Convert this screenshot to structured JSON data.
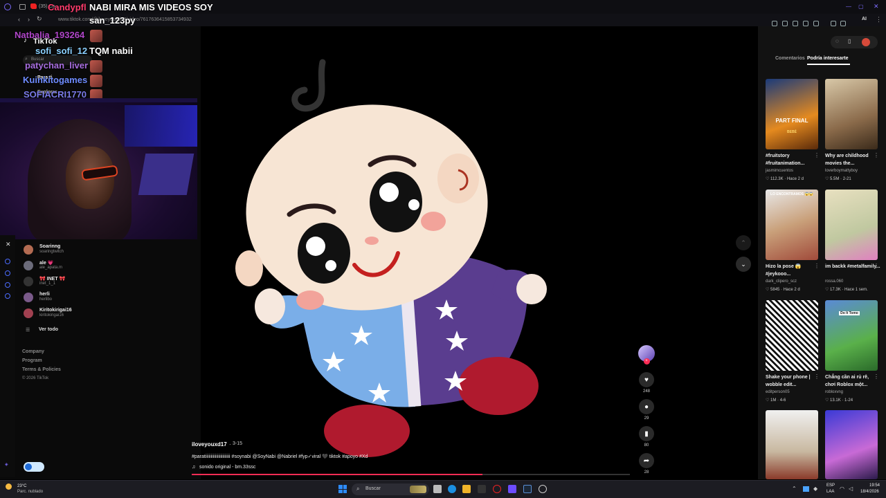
{
  "browser": {
    "tab_title": "(35) Ca",
    "url": "www.tiktok.com/@iloveyouxd17/video/7617636415853734932",
    "ext_label": "AI"
  },
  "stream": {
    "title": "NABI MIRA MIS VIDEOS SOY",
    "title_prefix_user": "Candypfl"
  },
  "chat": [
    {
      "user": "san_123py",
      "message": "",
      "color": "#ffffff"
    },
    {
      "user": "Natbalia_193264",
      "message": "",
      "color": "#b046c9"
    },
    {
      "user": "sofi_sofi_12",
      "message": "TQM nabii",
      "color": "#8ad0ff"
    },
    {
      "user": "patychan_liver",
      "message": "",
      "color": "#a86ee0"
    },
    {
      "user": "Kuinkitogames",
      "message": "",
      "color": "#6f8cff"
    },
    {
      "user": "SOFIACRI1770",
      "message": "",
      "color": "#7a7ae8"
    }
  ],
  "tiktok_nav": {
    "brand": "TikTok",
    "search_placeholder": "Buscar",
    "foryou": "Para ti",
    "explore": "Explorar"
  },
  "following": [
    {
      "name": "Soarinng",
      "handle": "soaringtwitch"
    },
    {
      "name": "ale 💗",
      "handle": "ale_apata.m"
    },
    {
      "name": "🎀 INET 🎀",
      "handle": "inet_1_1"
    },
    {
      "name": "herli",
      "handle": "herlibo"
    },
    {
      "name": "Kiritokirigai16",
      "handle": "kiritokirigai16"
    }
  ],
  "see_all": "Ver todo",
  "footer": [
    "Company",
    "Program",
    "Terms & Policies",
    "© 2026 TikTok"
  ],
  "video": {
    "author": "iloveyouxd17",
    "date": "3-15",
    "caption": "#paratiiiiiiiiiiiiiiiiiiiiiii #soynabi @SoyNabi @Nabriel #fyp✓viral 🖤 tiktok #apoyo #Xd",
    "sound": "sonido original - bm.33ssc",
    "likes": "248",
    "comments": "29",
    "saves": "80",
    "shares": "28"
  },
  "right_tabs": {
    "comments": "Comentarios",
    "related": "Podría interesarte"
  },
  "cards": [
    {
      "title": "#fruitstory #fruitanimation...",
      "author": "jasmimcuentos",
      "stats": "♡ 112.3K · Hace 2 d",
      "overlay": "PART FINAL",
      "overlay2": "BEBÉ"
    },
    {
      "title": "Why are childhood movies the...",
      "author": "loverboymattyboy",
      "stats": "♡ 5.5M · 2-21",
      "overlay": "",
      "overlay2": ""
    },
    {
      "title": "Hizo la pose 😱 #jeykooo...",
      "author": "dark_clipero_scz",
      "stats": "♡ 5845 · Hace 2 d",
      "overlay": "LO ENCONTRAMOS 😱😱",
      "overlay2": ""
    },
    {
      "title": "im backk #metalfamily...",
      "author": "rossa.060",
      "stats": "♡ 17.3K · Hace 1 sem.",
      "overlay": "",
      "overlay2": ""
    },
    {
      "title": "Shake your phone | wobble edit...",
      "author": "editperson05",
      "stats": "♡ 1M · 4-6",
      "overlay": "Shake your phone",
      "overlay2": ""
    },
    {
      "title": "Chẳng cần ai rủ rê, chơi Roblox một...",
      "author": "robloxvng",
      "stats": "♡ 13.1K · 1-24",
      "overlay": "Do It Tomo",
      "overlay2": ""
    },
    {
      "title": "",
      "author": "",
      "stats": "",
      "overlay": "",
      "overlay2": ""
    },
    {
      "title": "",
      "author": "",
      "stats": "",
      "overlay": "",
      "overlay2": ""
    }
  ],
  "taskbar": {
    "weather_temp": "23°C",
    "weather_desc": "Parc. nublado",
    "search": "Buscar",
    "lang": "ESP",
    "lang2": "LAA",
    "time": "19:54",
    "date": "18/4/2026"
  },
  "colors": {
    "accent": "#fe2c55",
    "tiktok_bg": "#000000"
  }
}
